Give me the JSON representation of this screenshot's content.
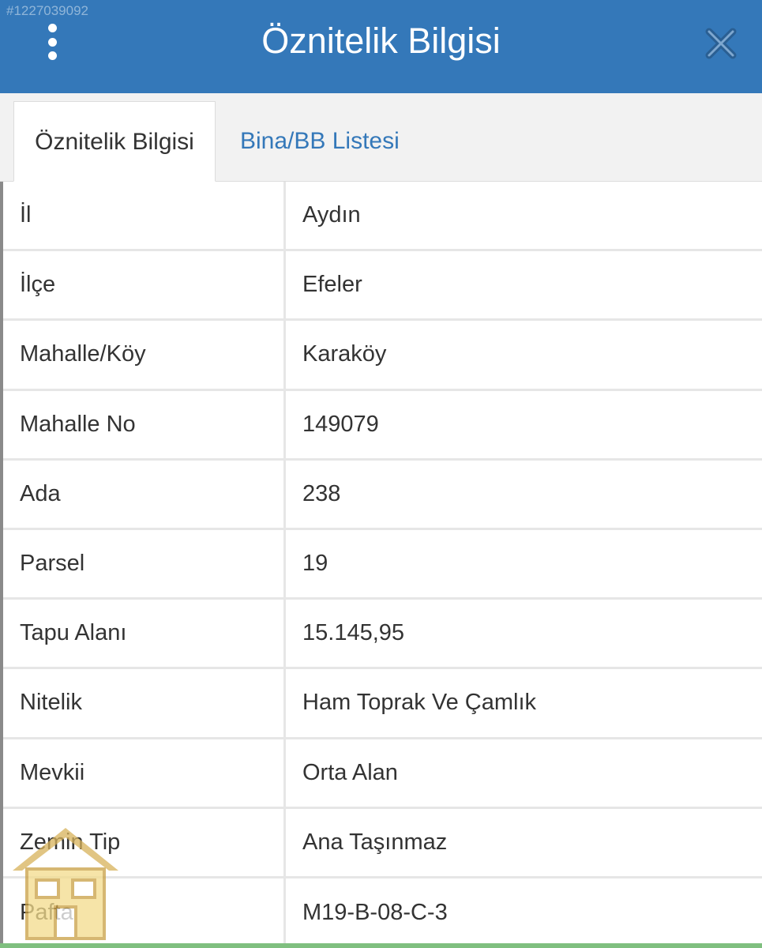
{
  "header": {
    "watermark_id": "#1227039092",
    "title": "Öznitelik Bilgisi",
    "menu_icon": "kebab-vertical-icon",
    "close_icon": "close-icon",
    "bg_color": "#3478b9"
  },
  "tabs": [
    {
      "label": "Öznitelik Bilgisi",
      "active": true
    },
    {
      "label": "Bina/BB Listesi",
      "active": false
    }
  ],
  "attributes": [
    {
      "key": "İl",
      "value": "Aydın"
    },
    {
      "key": "İlçe",
      "value": "Efeler"
    },
    {
      "key": "Mahalle/Köy",
      "value": "Karaköy"
    },
    {
      "key": "Mahalle No",
      "value": "149079"
    },
    {
      "key": "Ada",
      "value": "238"
    },
    {
      "key": "Parsel",
      "value": "19"
    },
    {
      "key": "Tapu Alanı",
      "value": "15.145,95"
    },
    {
      "key": "Nitelik",
      "value": "Ham Toprak Ve Çamlık"
    },
    {
      "key": "Mevkii",
      "value": "Orta Alan"
    },
    {
      "key": "Zemin Tip",
      "value": "Ana Taşınmaz"
    },
    {
      "key": "Pafta",
      "value": "M19-B-08-C-3"
    }
  ],
  "overlay_logo": "house-logo-icon"
}
